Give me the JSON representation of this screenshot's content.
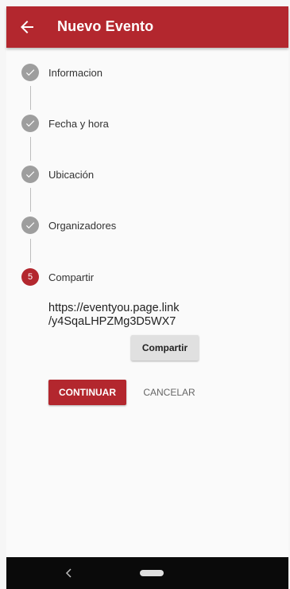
{
  "app_bar": {
    "title": "Nuevo Evento",
    "back_icon": "arrow-left-icon",
    "color": "#b3272e"
  },
  "stepper": {
    "steps": [
      {
        "label": "Informacion",
        "status": "complete",
        "icon": "check-icon"
      },
      {
        "label": "Fecha y hora",
        "status": "complete",
        "icon": "check-icon"
      },
      {
        "label": "Ubicación",
        "status": "complete",
        "icon": "check-icon"
      },
      {
        "label": "Organizadores",
        "status": "complete",
        "icon": "check-icon"
      },
      {
        "label": "Compartir",
        "status": "active",
        "number": "5"
      }
    ],
    "completed_color": "#9e9e9e",
    "active_color": "#b3272e"
  },
  "share": {
    "url_line1": "https://eventyou.page.link",
    "url_line2": "/y4SqaLHPZMg3D5WX7",
    "share_button": "Compartir"
  },
  "actions": {
    "continue": "CONTINUAR",
    "cancel": "CANCELAR"
  },
  "nav_bar": {
    "back_icon": "nav-back-icon",
    "home_icon": "nav-home-pill-icon"
  }
}
